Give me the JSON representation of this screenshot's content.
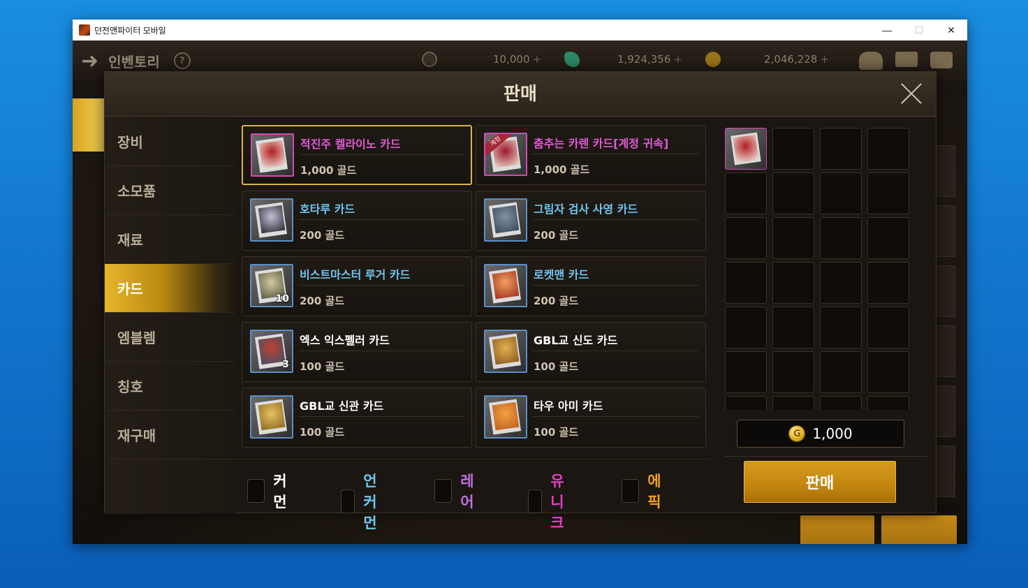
{
  "window": {
    "title": "던전앤파이터 모바일",
    "controls": {
      "minimize": "—",
      "maximize": "☐",
      "close": "✕"
    }
  },
  "background": {
    "inventory_title": "인벤토리",
    "help": "?",
    "currencies": [
      {
        "icon": "c-coin-icon",
        "value": "10,000"
      },
      {
        "icon": "gem-icon",
        "value": "1,924,356"
      },
      {
        "icon": "gold-icon",
        "value": "2,046,228"
      }
    ]
  },
  "modal": {
    "title": "판매",
    "menu": [
      {
        "label": "장비",
        "active": false
      },
      {
        "label": "소모품",
        "active": false
      },
      {
        "label": "재료",
        "active": false
      },
      {
        "label": "카드",
        "active": true
      },
      {
        "label": "엠블렘",
        "active": false
      },
      {
        "label": "칭호",
        "active": false
      },
      {
        "label": "재구매",
        "active": false
      }
    ],
    "items": [
      {
        "name": "적진주 켈라이노 카드",
        "price": "1,000 골드",
        "name_color": "#e05ad8",
        "thumb": "pink",
        "selected": true,
        "count": "",
        "account_ribbon": ""
      },
      {
        "name": "춤추는 카렌 카드[계정 귀속]",
        "price": "1,000 골드",
        "name_color": "#e05ad8",
        "thumb": "pink",
        "selected": false,
        "count": "",
        "account_ribbon": "계정"
      },
      {
        "name": "호타루 카드",
        "price": "200 골드",
        "name_color": "#6ec6f0",
        "thumb": "blue",
        "selected": false,
        "count": "",
        "account_ribbon": ""
      },
      {
        "name": "그림자 검사 사영 카드",
        "price": "200 골드",
        "name_color": "#6ec6f0",
        "thumb": "blue",
        "selected": false,
        "count": "",
        "account_ribbon": ""
      },
      {
        "name": "비스트마스터 루거 카드",
        "price": "200 골드",
        "name_color": "#6ec6f0",
        "thumb": "blue",
        "selected": false,
        "count": "10",
        "account_ribbon": ""
      },
      {
        "name": "로켓맨 카드",
        "price": "200 골드",
        "name_color": "#6ec6f0",
        "thumb": "blue",
        "selected": false,
        "count": "",
        "account_ribbon": ""
      },
      {
        "name": "엑스 익스펠러 카드",
        "price": "100 골드",
        "name_color": "#ffffff",
        "thumb": "blue",
        "selected": false,
        "count": "3",
        "account_ribbon": ""
      },
      {
        "name": "GBL교 신도 카드",
        "price": "100 골드",
        "name_color": "#ffffff",
        "thumb": "blue",
        "selected": false,
        "count": "",
        "account_ribbon": ""
      },
      {
        "name": "GBL교 신관 카드",
        "price": "100 골드",
        "name_color": "#ffffff",
        "thumb": "blue",
        "selected": false,
        "count": "",
        "account_ribbon": ""
      },
      {
        "name": "타우 아미 카드",
        "price": "100 골드",
        "name_color": "#ffffff",
        "thumb": "blue",
        "selected": false,
        "count": "",
        "account_ribbon": ""
      }
    ],
    "filters": [
      {
        "label": "커먼",
        "color": "#ffffff"
      },
      {
        "label": "언커먼",
        "color": "#6ec6f0"
      },
      {
        "label": "레어",
        "color": "#c070e0"
      },
      {
        "label": "유니크",
        "color": "#e040c8"
      },
      {
        "label": "에픽",
        "color": "#f0a020"
      }
    ],
    "sell_slots_filled": 1,
    "total": "1,000",
    "sell_button": "판매"
  }
}
